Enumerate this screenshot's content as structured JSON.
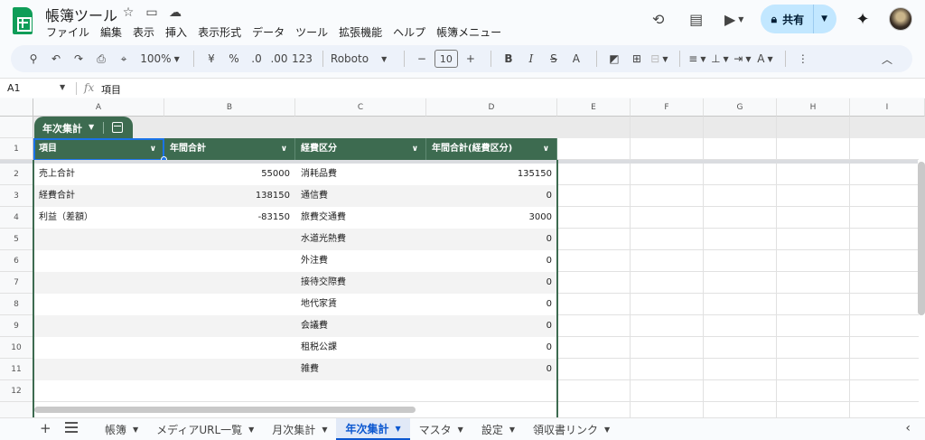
{
  "app": {
    "doc_title": "帳簿ツール",
    "menus": [
      "ファイル",
      "編集",
      "表示",
      "挿入",
      "表示形式",
      "データ",
      "ツール",
      "拡張機能",
      "ヘルプ",
      "帳簿メニュー"
    ],
    "share_label": "共有",
    "colors": {
      "brand": "#0f9d58",
      "table_header": "#3d6b50",
      "share_bg": "#c2e7ff",
      "accent": "#0b57d0"
    }
  },
  "toolbar": {
    "zoom": "100%",
    "currency": "¥",
    "percent": "%",
    "dec_decrease": ".0",
    "dec_increase": ".00",
    "format_more": "123",
    "font": "Roboto",
    "font_size": "10",
    "bold": "B",
    "italic": "I",
    "strike": "S",
    "text_color": "A"
  },
  "formula_bar": {
    "cell_ref": "A1",
    "fx": "fx",
    "content": "項目"
  },
  "columns": [
    "A",
    "B",
    "C",
    "D",
    "E",
    "F",
    "G",
    "H",
    "I"
  ],
  "rows": [
    "1",
    "2",
    "3",
    "4",
    "5",
    "6",
    "7",
    "8",
    "9",
    "10",
    "11",
    "12"
  ],
  "table": {
    "name": "年次集計",
    "headers": [
      "項目",
      "年間合計",
      "経費区分",
      "年間合計(経費区分)"
    ],
    "rows": [
      [
        "売上合計",
        "55000",
        "消耗品費",
        "135150"
      ],
      [
        "経費合計",
        "138150",
        "通信費",
        "0"
      ],
      [
        "利益（差額）",
        "-83150",
        "旅費交通費",
        "3000"
      ],
      [
        "",
        "",
        "水道光熱費",
        "0"
      ],
      [
        "",
        "",
        "外注費",
        "0"
      ],
      [
        "",
        "",
        "接待交際費",
        "0"
      ],
      [
        "",
        "",
        "地代家賃",
        "0"
      ],
      [
        "",
        "",
        "会議費",
        "0"
      ],
      [
        "",
        "",
        "租税公課",
        "0"
      ],
      [
        "",
        "",
        "雑費",
        "0"
      ]
    ]
  },
  "sheet_tabs": [
    {
      "label": "帳簿",
      "active": false
    },
    {
      "label": "メディアURL一覧",
      "active": false
    },
    {
      "label": "月次集計",
      "active": false
    },
    {
      "label": "年次集計",
      "active": true
    },
    {
      "label": "マスタ",
      "active": false
    },
    {
      "label": "設定",
      "active": false
    },
    {
      "label": "領収書リンク",
      "active": false
    }
  ]
}
